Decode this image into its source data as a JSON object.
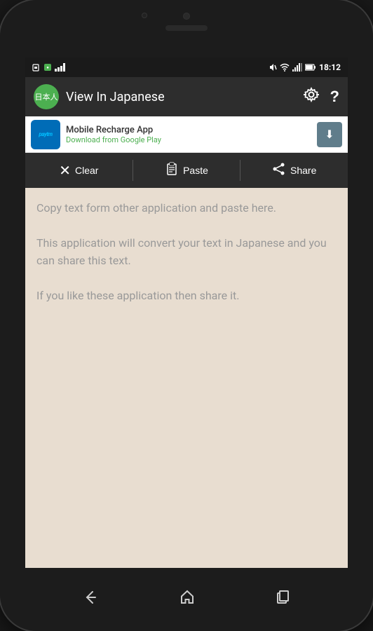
{
  "phone": {
    "statusBar": {
      "time": "18:12",
      "icons": {
        "mute": "🔇",
        "wifi": "wifi",
        "signal": "signal",
        "battery": "battery"
      }
    },
    "appBar": {
      "title": "View In Japanese",
      "iconLabel": "日本人",
      "settingsLabel": "⚙",
      "helpLabel": "?"
    },
    "adBanner": {
      "logoText": "paytm",
      "adTitle": "Mobile Recharge App",
      "adSubtitle": "Download from Google Play",
      "downloadIcon": "⬇"
    },
    "toolbar": {
      "clearIcon": "✕",
      "clearLabel": "Clear",
      "pasteIcon": "📋",
      "pasteLabel": "Paste",
      "shareIcon": "share",
      "shareLabel": "Share"
    },
    "textArea": {
      "line1": "Copy text form other application and paste here.",
      "line2": "This application will convert your text in Japanese and you can share this text.",
      "line3": "If you like these application then share it."
    },
    "navBar": {
      "backIcon": "back",
      "homeIcon": "home",
      "recentIcon": "recent"
    }
  }
}
